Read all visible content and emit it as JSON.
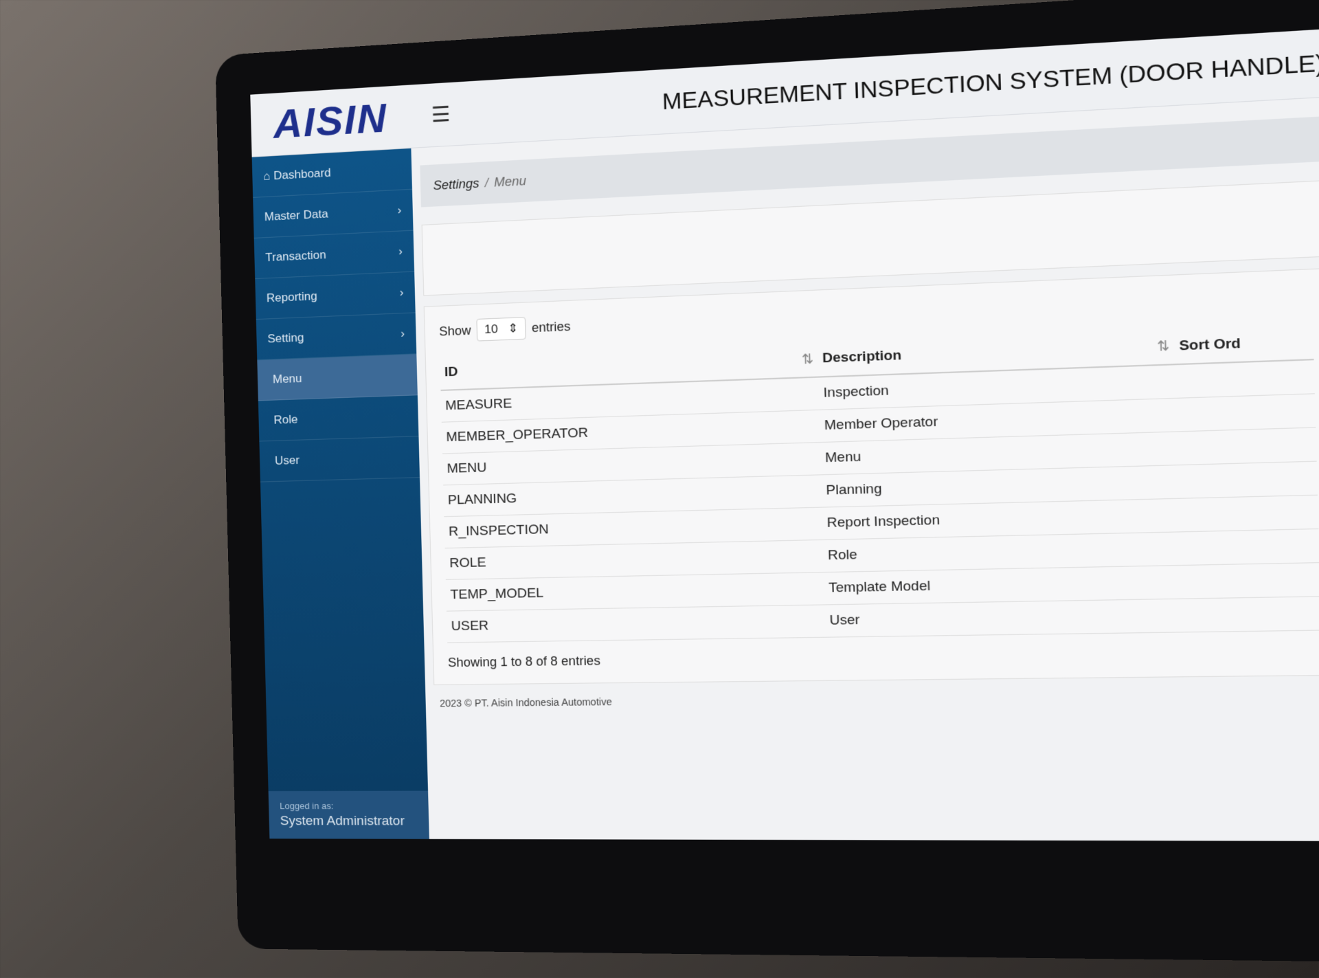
{
  "header": {
    "logo": "AISIN",
    "title": "MEASUREMENT INSPECTION SYSTEM (DOOR HANDLE)"
  },
  "sidebar": {
    "items": [
      {
        "label": "Dashboard",
        "icon": "home-icon"
      },
      {
        "label": "Master Data",
        "chevron": "›"
      },
      {
        "label": "Transaction",
        "chevron": "›"
      },
      {
        "label": "Reporting",
        "chevron": "›"
      },
      {
        "label": "Setting",
        "chevron": "›"
      },
      {
        "label": "Menu",
        "active": true
      },
      {
        "label": "Role"
      },
      {
        "label": "User"
      }
    ],
    "logged_label": "Logged in as:",
    "logged_user": "System Administrator"
  },
  "breadcrumb": {
    "parent": "Settings",
    "sep": "/",
    "current": "Menu"
  },
  "table": {
    "show_label": "Show",
    "page_size": "10",
    "entries_label": "entries",
    "columns": [
      "ID",
      "Description",
      "Sort Ord"
    ],
    "rows": [
      [
        "MEASURE",
        "Inspection"
      ],
      [
        "MEMBER_OPERATOR",
        "Member Operator"
      ],
      [
        "MENU",
        "Menu"
      ],
      [
        "PLANNING",
        "Planning"
      ],
      [
        "R_INSPECTION",
        "Report Inspection"
      ],
      [
        "ROLE",
        "Role"
      ],
      [
        "TEMP_MODEL",
        "Template Model"
      ],
      [
        "USER",
        "User"
      ]
    ],
    "info": "Showing 1 to 8 of 8 entries"
  },
  "footer": "2023 © PT. Aisin Indonesia Automotive"
}
